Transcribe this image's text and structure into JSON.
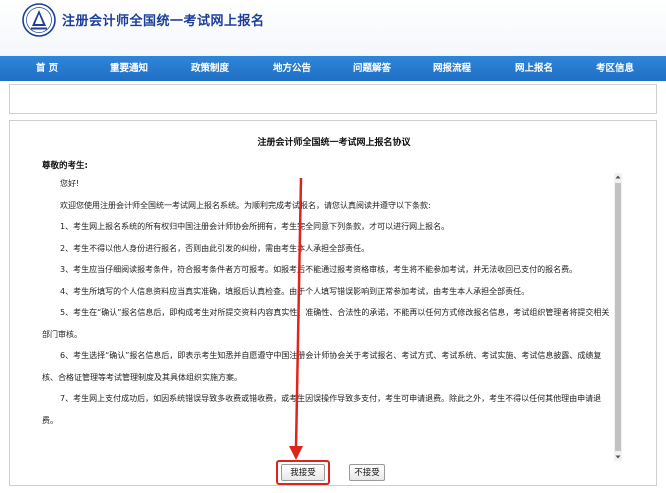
{
  "header": {
    "title": "注册会计师全国统一考试网上报名"
  },
  "nav": {
    "items": [
      {
        "label": "首  页"
      },
      {
        "label": "重要通知"
      },
      {
        "label": "政策制度"
      },
      {
        "label": "地方公告"
      },
      {
        "label": "问题解答"
      },
      {
        "label": "网报流程"
      },
      {
        "label": "网上报名"
      },
      {
        "label": "考区信息"
      }
    ]
  },
  "agreement": {
    "title": "注册会计师全国统一考试网上报名协议",
    "salutation": "尊敬的考生:",
    "greeting": "您好!",
    "intro": "欢迎您使用注册会计师全国统一考试网上报名系统。为顺利完成考试报名，请您认真阅读并遵守以下条款:",
    "clauses": [
      "1、考生网上报名系统的所有权归中国注册会计师协会所拥有，考生完全同意下列条款，才可以进行网上报名。",
      "2、考生不得以他人身份进行报名，否则由此引发的纠纷，需由考生本人承担全部责任。",
      "3、考生应当仔细阅读报考条件，符合报考条件者方可报考。如报考后不能通过报考资格审核，考生将不能参加考试，并无法收回已支付的报名费。",
      "4、考生所填写的个人信息资料应当真实准确，填报后认真检查。由于个人填写错误影响到正常参加考试，由考生本人承担全部责任。",
      "5、考生在“确认”报名信息后，即构成考生对所提交资料内容真实性、准确性、合法性的承诺，不能再以任何方式修改报名信息，考试组织管理者将提交相关部门审核。",
      "6、考生选择“确认”报名信息后，即表示考生知悉并自愿遵守中国注册会计师协会关于考试报名、考试方式、考试系统、考试实施、考试信息披露、成绩复核、合格证管理等考试管理制度及其具体组织实施方案。",
      "7、考生网上支付成功后，如因系统错误导致多收费或错收费，或考生因误操作导致多支付，考生可申请退费。除此之外，考生不得以任何其他理由申请退费。"
    ],
    "accept_label": "我接受",
    "reject_label": "不接受"
  }
}
